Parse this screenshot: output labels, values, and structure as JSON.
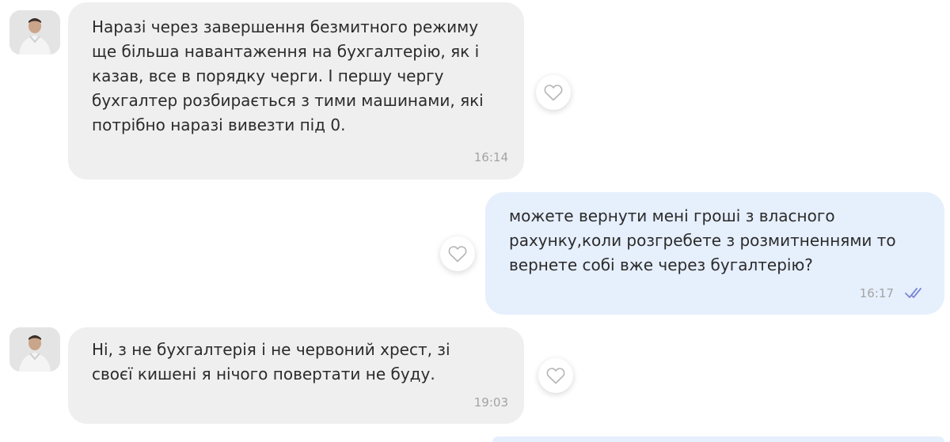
{
  "messages": [
    {
      "direction": "incoming",
      "text": "Наразі через завершення безмитного режиму\nще більша навантаження на бухгалтерію, як і\nказав, все в порядку черги. І першу чергу\nбухгалтер розбирається з тими машинами, які\nпотрібно наразі вивезти під 0.",
      "time": "16:14"
    },
    {
      "direction": "outgoing",
      "text": "можете вернути мені гроші з власного\nрахунку,коли  розгребете з розмитненнями то\nвернете собі вже через бугалтерію?",
      "time": "16:17",
      "status_icon": "double-check-icon"
    },
    {
      "direction": "incoming",
      "text": "Ні, з не бухгалтерія і не червоний хрест, зі\nсвоєї кишені я нічого повертати не буду.",
      "time": "19:03"
    }
  ],
  "colors": {
    "incoming_bubble": "#efefef",
    "outgoing_bubble": "#e6effc",
    "read_check": "#7a86d6",
    "time_text": "#a3a3a3"
  }
}
